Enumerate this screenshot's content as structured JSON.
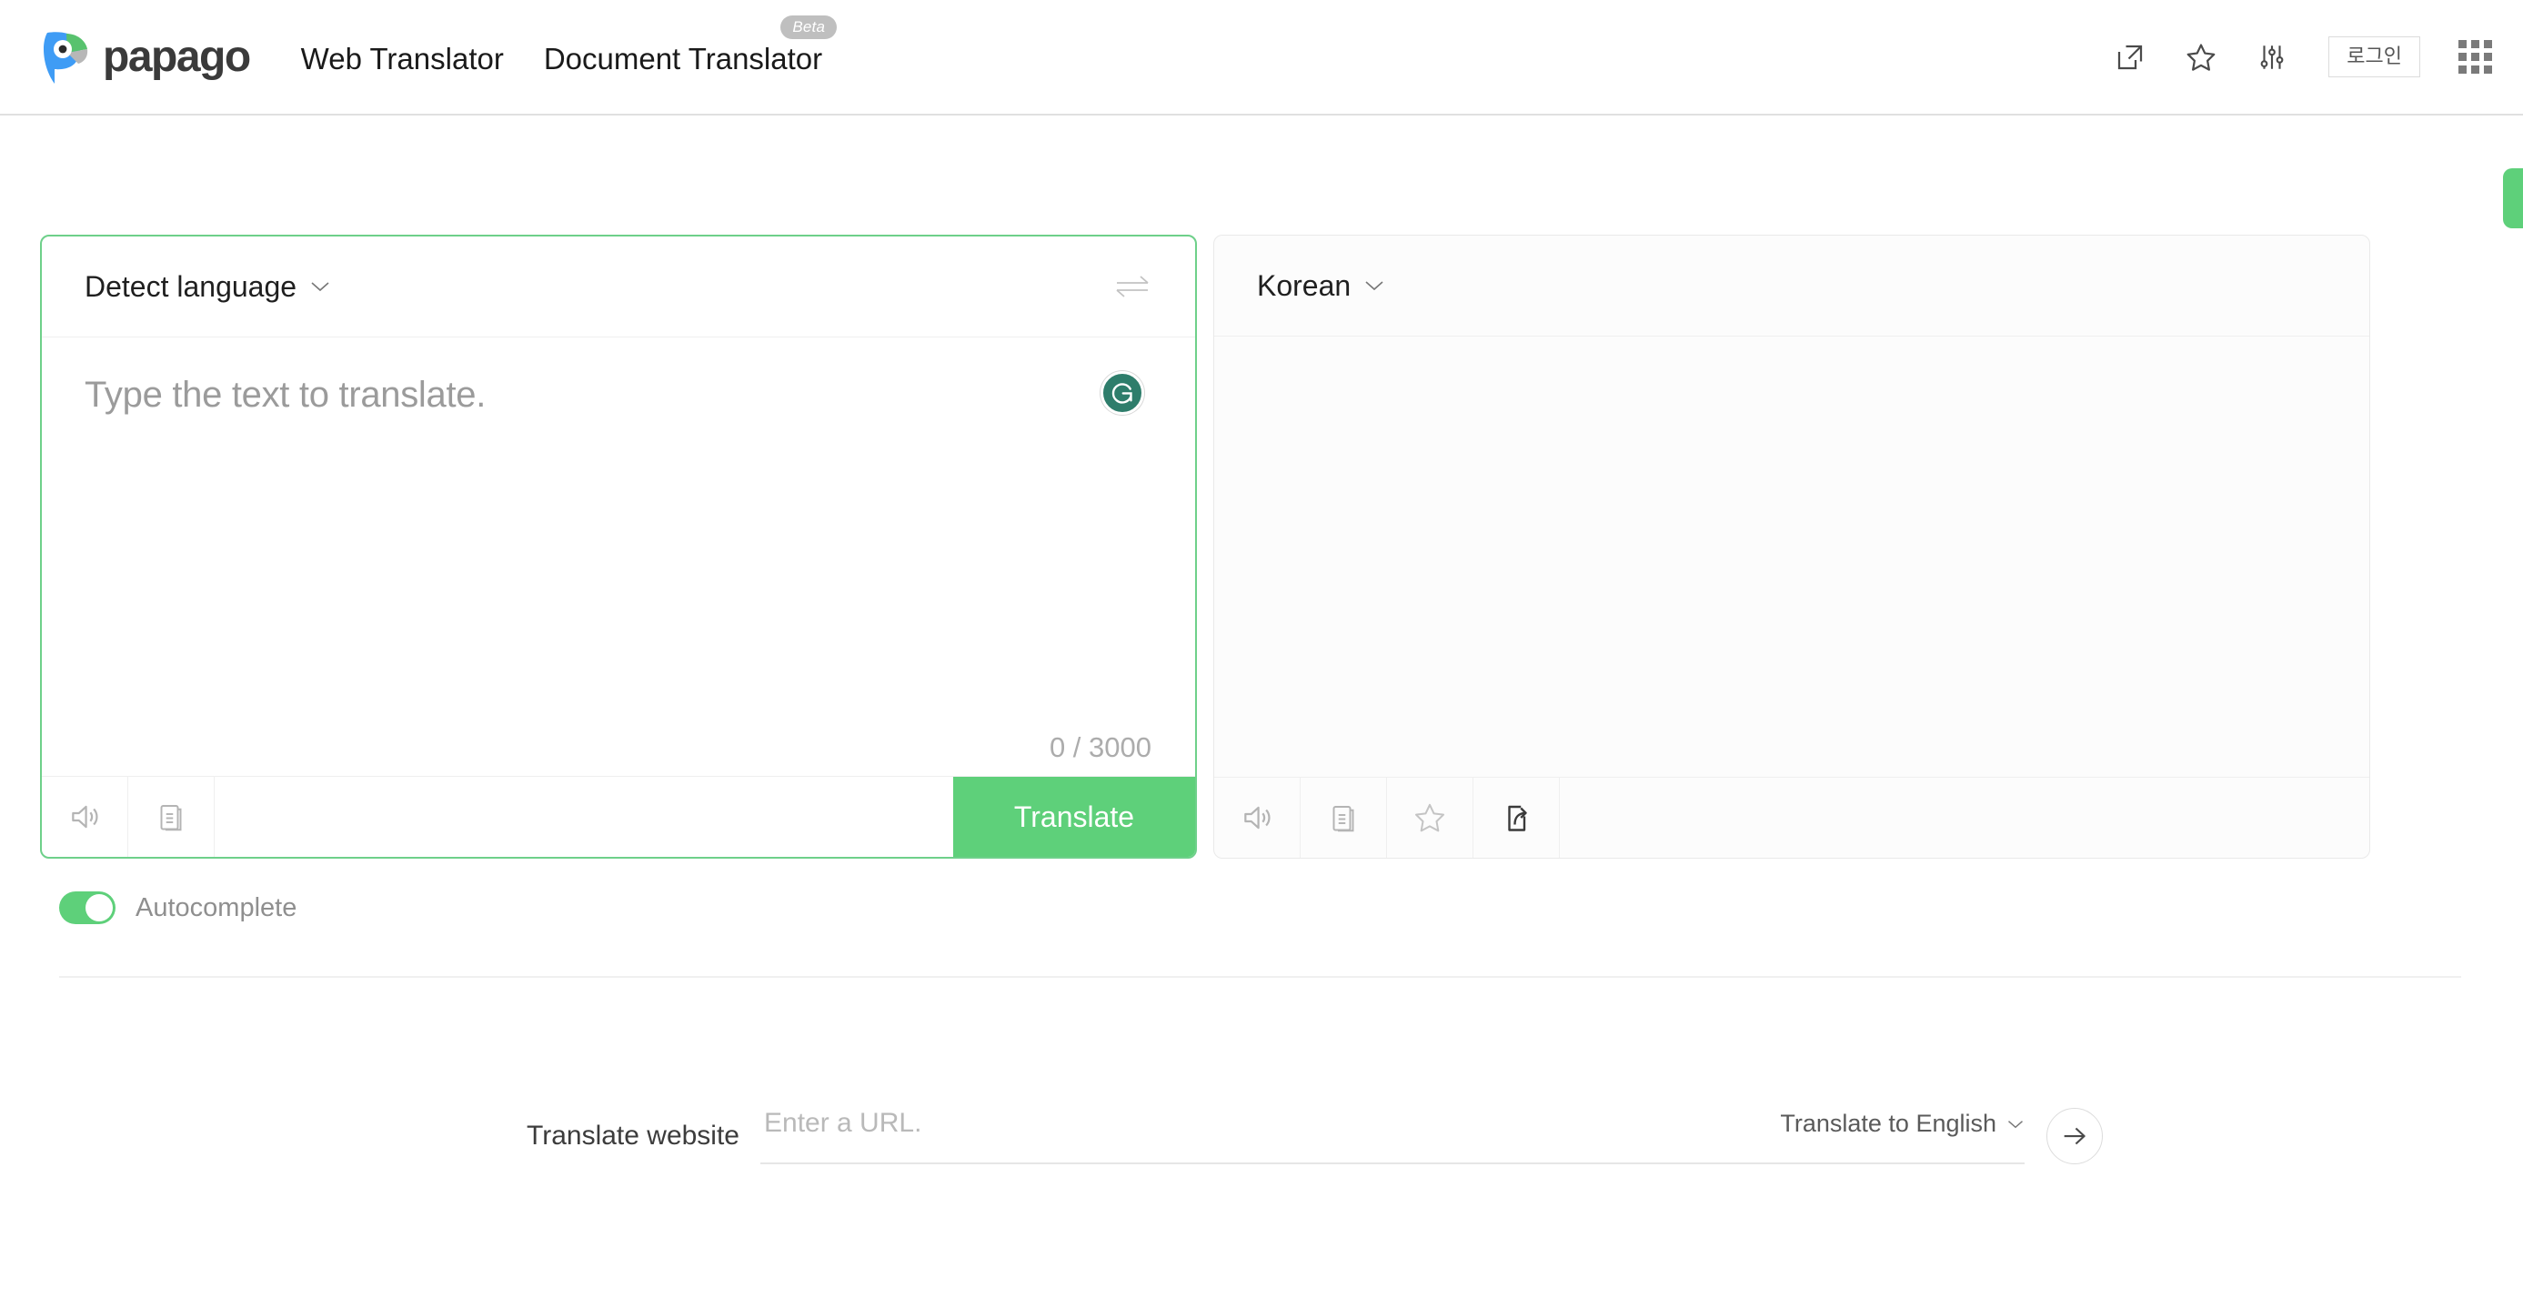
{
  "header": {
    "brand": "papago",
    "brand_icon": "parrot-logo-icon",
    "nav": [
      {
        "label": "Web Translator",
        "badge": null
      },
      {
        "label": "Document Translator",
        "badge": "Beta"
      }
    ],
    "actions": [
      {
        "name": "popup-window-icon"
      },
      {
        "name": "star-icon"
      },
      {
        "name": "settings-sliders-icon"
      }
    ],
    "login_label": "로그인",
    "apps_grid_icon": "apps-grid-icon"
  },
  "edge_tab": {
    "name": "side-panel-tab",
    "color": "#5ed07a"
  },
  "source_panel": {
    "language": "Detect language",
    "placeholder": "Type the text to translate.",
    "counter": "0 / 3000",
    "grammarly_icon": "grammarly-icon",
    "swap_icon": "swap-languages-icon",
    "tools": [
      {
        "name": "speaker-icon"
      },
      {
        "name": "copy-icon"
      }
    ],
    "translate_label": "Translate"
  },
  "target_panel": {
    "language": "Korean",
    "text": "",
    "tools": [
      {
        "name": "speaker-icon"
      },
      {
        "name": "copy-icon"
      },
      {
        "name": "star-icon"
      },
      {
        "name": "share-icon"
      }
    ]
  },
  "autocomplete": {
    "label": "Autocomplete",
    "enabled": true
  },
  "website_translate": {
    "label": "Translate website",
    "url_value": "",
    "url_placeholder": "Enter a URL.",
    "target_language": "Translate to English",
    "go_icon": "arrow-right-icon"
  },
  "colors": {
    "accent_green": "#5ed07a",
    "border_green": "#6ed08a",
    "grammarly_teal": "#2e7d6b",
    "text_dark": "#1a1a1a",
    "text_muted": "#9b9b9b"
  }
}
